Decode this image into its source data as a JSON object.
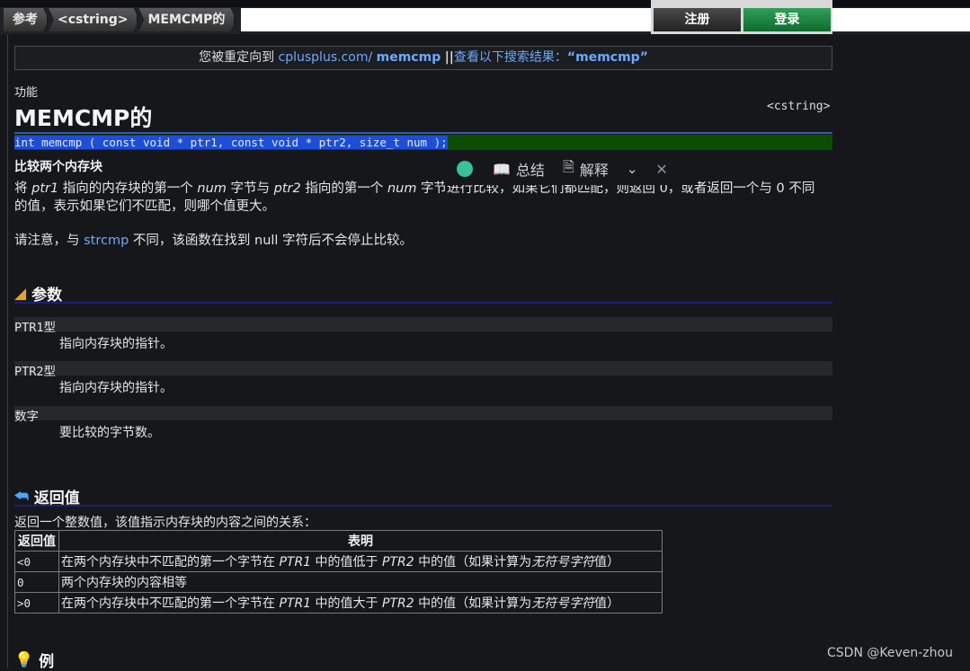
{
  "breadcrumbs": [
    "参考",
    "<cstring>",
    "MEMCMP的"
  ],
  "auth": {
    "register": "注册",
    "login": "登录"
  },
  "redirect": {
    "prefix": "您被重定向到",
    "site": "cplusplus.com/",
    "term": "memcmp",
    "sep": "||",
    "search_text": "查看以下搜索结果：",
    "search_term": "“memcmp”"
  },
  "kicker": "功能",
  "title": "MEMCMP的",
  "header_tag": "<cstring>",
  "prototype": "int memcmp ( const void * ptr1, const void * ptr2, size_t num );",
  "popup": {
    "summary": "总结",
    "explain": "解释"
  },
  "subtitle": "比较两个内存块",
  "desc": {
    "a": "将 ",
    "ptr1": "ptr1",
    "b": " 指向的内存块的第一个 ",
    "num": "num",
    "c": " 字节与 ",
    "ptr2": "ptr2",
    "d": " 指向的第一个 ",
    "num2": "num",
    "e": " 字节进行比较，如果它们都匹配，则返回 0，或者返回一个与 0 不同的值，表示如果它们不匹配，则哪个值更大。"
  },
  "note": {
    "a": "请注意，与 ",
    "link": "strcmp",
    "b": " 不同，该函数在找到 null 字符后不会停止比较。"
  },
  "sections": {
    "params": "参数",
    "return": "返回值",
    "example": "例"
  },
  "params": [
    {
      "name": "PTR1型",
      "desc": "指向内存块的指针。"
    },
    {
      "name": "PTR2型",
      "desc": "指向内存块的指针。"
    },
    {
      "name": "数字",
      "desc": "要比较的字节数。"
    }
  ],
  "return_intro": "返回一个整数值，该值指示内存块的内容之间的关系：",
  "table": {
    "headers": [
      "返回值",
      "表明"
    ],
    "rows": [
      {
        "code": "<0",
        "a": "在两个内存块中不匹配的第一个字节在 ",
        "p1": "PTR1",
        "b": " 中的值低于 ",
        "p2": "PTR2",
        "c": " 中的值（如果计算为",
        "u": "无符号字符",
        "d": "值）"
      },
      {
        "code": "0",
        "a": "两个内存块的内容相等"
      },
      {
        "code": ">0",
        "a": "在两个内存块中不匹配的第一个字节在 ",
        "p1": "PTR1",
        "b": " 中的值大于 ",
        "p2": "PTR2",
        "c": " 中的值（如果计算为",
        "u": "无符号字符",
        "d": "值）"
      }
    ]
  },
  "watermark": "CSDN @Keven-zhou",
  "colors": {
    "link": "#6fa8ff",
    "login": "#1e8a45",
    "proto_bg": "#0a4d00",
    "section_rule": "#18207a"
  }
}
